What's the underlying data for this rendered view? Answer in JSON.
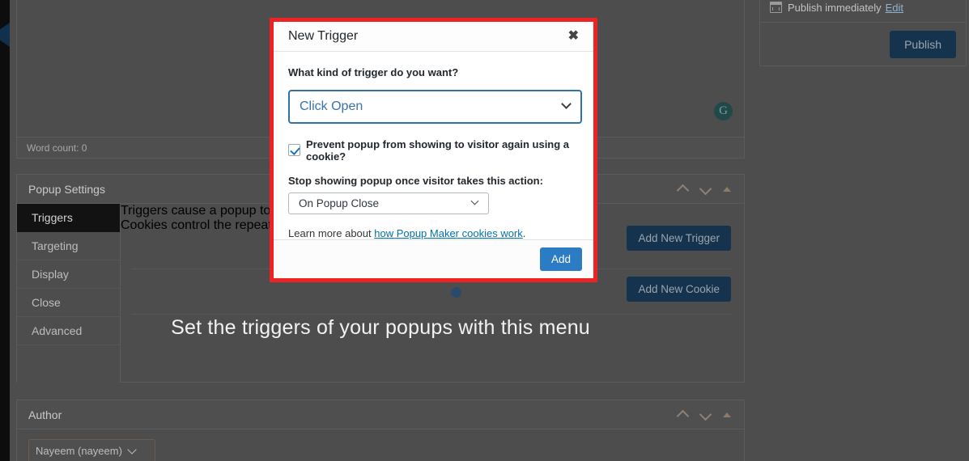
{
  "editor": {
    "word_count_label": "Word count: 0",
    "grammarly_icon": "grammarly-icon",
    "grammarly_glyph": "G"
  },
  "popup_settings": {
    "title": "Popup Settings",
    "tabs": [
      {
        "label": "Triggers",
        "active": true
      },
      {
        "label": "Targeting",
        "active": false
      },
      {
        "label": "Display",
        "active": false
      },
      {
        "label": "Close",
        "active": false
      },
      {
        "label": "Advanced",
        "active": false
      }
    ],
    "triggers_desc": "Triggers cause a popup to open.",
    "add_trigger_label": "Add New Trigger",
    "cookies_desc": "Cookies control the repeat display of a popup.",
    "add_cookie_label": "Add New Cookie",
    "overlay_caption": "Set the triggers of your popups with this menu"
  },
  "author": {
    "title": "Author",
    "selected": "Nayeem (nayeem)"
  },
  "publish": {
    "schedule_text": "Publish immediately",
    "edit_label": "Edit",
    "publish_label": "Publish",
    "calendar_icon": "calendar-icon"
  },
  "modal": {
    "title": "New Trigger",
    "close_glyph": "✖",
    "question_label": "What kind of trigger do you want?",
    "trigger_type_value": "Click Open",
    "cookie_checkbox_label": "Prevent popup from showing to visitor again using a cookie?",
    "cookie_checked": true,
    "stop_showing_label": "Stop showing popup once visitor takes this action:",
    "stop_showing_value": "On Popup Close",
    "learn_more_prefix": "Learn more about ",
    "learn_more_link": "how Popup Maker cookies work",
    "learn_more_suffix": ".",
    "add_button_label": "Add"
  },
  "colors": {
    "highlight_red": "#ee2222",
    "accent_blue": "#2b7cc4",
    "dark_button": "#16334e",
    "link_blue": "#0073aa"
  }
}
